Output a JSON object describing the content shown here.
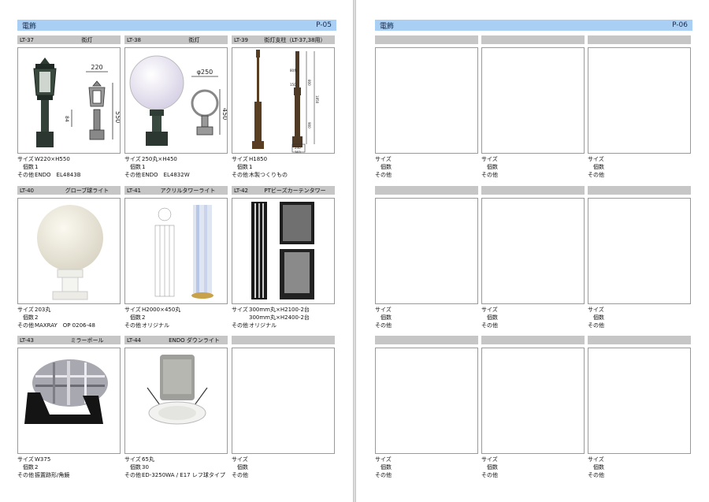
{
  "left_page": {
    "title": "電飾",
    "page_number": "P-05",
    "items": [
      {
        "code": "LT-37",
        "name": "街灯",
        "size": "W220×H550",
        "qty": "1",
        "other": "ENDO　EL4843B",
        "dim_width": "220",
        "dim_height": "550",
        "dim_base": "84"
      },
      {
        "code": "LT-38",
        "name": "街灯",
        "size": "250丸×H450",
        "qty": "1",
        "other": "ENDO　EL4832W",
        "dim_width": "φ250",
        "dim_height": "450"
      },
      {
        "code": "LT-39",
        "name": "街灯支柱（LT-37,38用）",
        "size": "H1850",
        "qty": "1",
        "other": "木製つくりもの",
        "dim_total": "1850",
        "dim_upper": "800",
        "dim_mid": "150",
        "dim_lower": "900",
        "dim_a": "240",
        "dim_b": "363",
        "dim_c": "80角"
      },
      {
        "code": "LT-40",
        "name": "グローブ球ライト",
        "size": "203丸",
        "qty": "2",
        "other": "MAXRAY　OP 0206-48"
      },
      {
        "code": "LT-41",
        "name": "アクリルタワーライト",
        "size": "H2000×450丸",
        "qty": "2",
        "other": "オリジナル"
      },
      {
        "code": "LT-42",
        "name": "PTビーズカーテンタワー",
        "size": "300mm丸×H2100-2台",
        "size2": "300mm丸×H2400-2台",
        "qty": "",
        "other": "オリジナル"
      },
      {
        "code": "LT-43",
        "name": "ミラーボール",
        "size": "W375",
        "qty": "2",
        "other": "振置跡形/角鏡"
      },
      {
        "code": "LT-44",
        "name": "ENDO ダウンライト",
        "size": "65丸",
        "qty": "30",
        "other": "ED-3250WA / E17 レフ球タイプ"
      },
      {
        "code": "",
        "name": "",
        "size": "",
        "qty": "",
        "other": ""
      }
    ]
  },
  "right_page": {
    "title": "電飾",
    "page_number": "P-06",
    "items": [
      {
        "code": "",
        "name": "",
        "size": "",
        "qty": "",
        "other": ""
      },
      {
        "code": "",
        "name": "",
        "size": "",
        "qty": "",
        "other": ""
      },
      {
        "code": "",
        "name": "",
        "size": "",
        "qty": "",
        "other": ""
      },
      {
        "code": "",
        "name": "",
        "size": "",
        "qty": "",
        "other": ""
      },
      {
        "code": "",
        "name": "",
        "size": "",
        "qty": "",
        "other": ""
      },
      {
        "code": "",
        "name": "",
        "size": "",
        "qty": "",
        "other": ""
      },
      {
        "code": "",
        "name": "",
        "size": "",
        "qty": "",
        "other": ""
      },
      {
        "code": "",
        "name": "",
        "size": "",
        "qty": "",
        "other": ""
      },
      {
        "code": "",
        "name": "",
        "size": "",
        "qty": "",
        "other": ""
      }
    ]
  },
  "labels": {
    "size": "サイズ",
    "qty": "個数",
    "other": "その他"
  },
  "colors": {
    "header_bar": "#a9cff5",
    "cell_header": "#c6c6c6",
    "border": "#9a9a9a"
  }
}
